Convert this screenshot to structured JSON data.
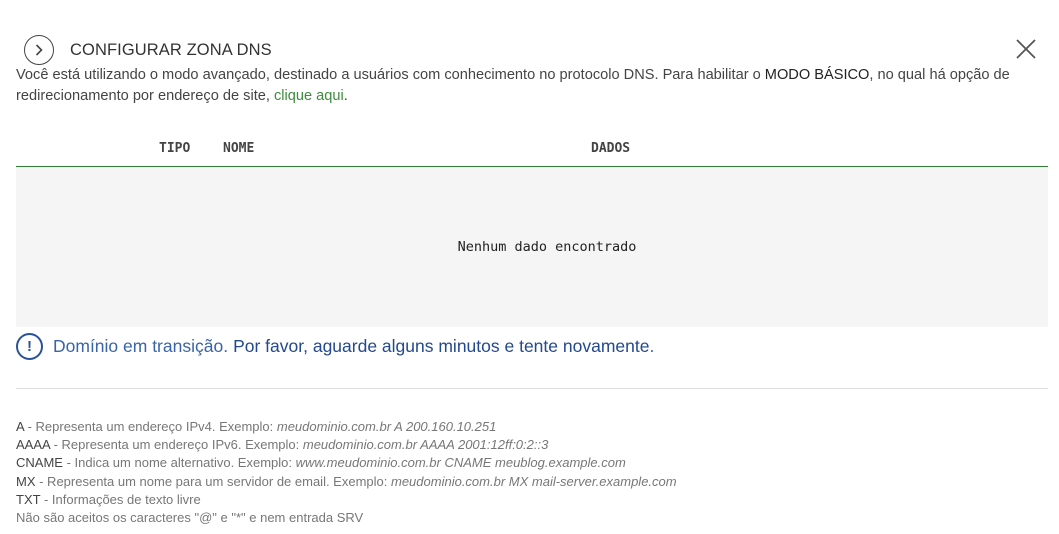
{
  "header": {
    "title": "CONFIGURAR ZONA DNS",
    "back_icon": "chevron-right-icon",
    "close_icon": "close-icon"
  },
  "intro": {
    "text_before": "Você está utilizando o modo avançado, destinado a usuários com conhecimento no protocolo DNS. Para habilitar o ",
    "mode_label": "MODO BÁSICO",
    "text_middle": ", no qual há opção de redirecionamento por endereço de site, ",
    "link_label": "clique aqui",
    "text_end": "."
  },
  "table": {
    "columns": [
      "TIPO",
      "NOME",
      "DADOS"
    ],
    "empty_message": "Nenhum dado encontrado"
  },
  "alert": {
    "icon": "exclamation-circle-icon",
    "title": "Domínio em transição.",
    "message": "Por favor, aguarde alguns minutos e tente novamente",
    "end": "."
  },
  "legend": [
    {
      "key": "A",
      "desc": " - Representa um endereço IPv4. Exemplo: ",
      "example": "meudominio.com.br A 200.160.10.251"
    },
    {
      "key": "AAAA",
      "desc": " - Representa um endereço IPv6. Exemplo: ",
      "example": "meudominio.com.br AAAA 2001:12ff:0:2::3"
    },
    {
      "key": "CNAME",
      "desc": " - Indica um nome alternativo. Exemplo: ",
      "example": "www.meudominio.com.br CNAME meublog.example.com"
    },
    {
      "key": "MX",
      "desc": " - Representa um nome para um servidor de email. Exemplo: ",
      "example": "meudominio.com.br MX mail-server.example.com"
    },
    {
      "key": "TXT",
      "desc": " - Informações de texto livre",
      "example": ""
    }
  ],
  "legend_note": "Não são aceitos os caracteres \"@\" e \"*\" e nem entrada SRV",
  "colors": {
    "accent_green": "#2e7d32",
    "link_green": "#3d8b3d",
    "alert_blue": "#2a5298"
  }
}
